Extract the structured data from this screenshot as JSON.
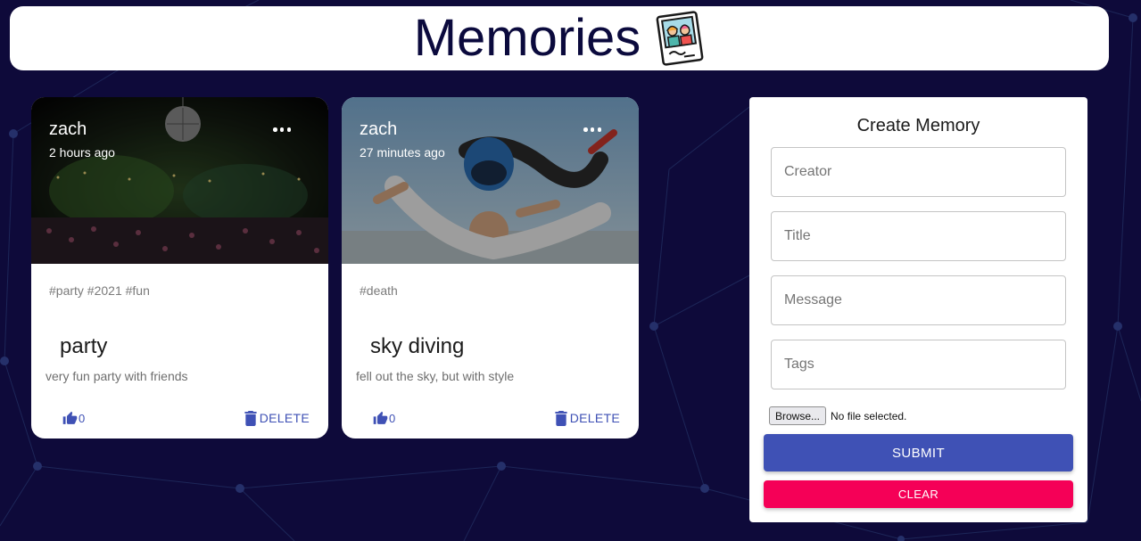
{
  "app": {
    "title": "Memories",
    "logo_icon": "memories-photo-logo-icon"
  },
  "posts": [
    {
      "creator": "zach",
      "time": "2 hours ago",
      "tags": "#party #2021 #fun",
      "title": "party",
      "message": "very fun party with friends",
      "likes": "0",
      "delete_label": "DELETE",
      "image": "concert-crowd-disco-ball"
    },
    {
      "creator": "zach",
      "time": "27 minutes ago",
      "tags": "#death",
      "title": "sky diving",
      "message": "fell out the sky, but with style",
      "likes": "0",
      "delete_label": "DELETE",
      "image": "tandem-skydivers"
    }
  ],
  "form": {
    "title": "Create Memory",
    "creator_placeholder": "Creator",
    "title_placeholder": "Title",
    "message_placeholder": "Message",
    "tags_placeholder": "Tags",
    "browse_label": "Browse...",
    "file_status": "No file selected.",
    "submit_label": "SUBMIT",
    "clear_label": "CLEAR"
  },
  "colors": {
    "background": "#0e0a3a",
    "primary": "#3f51b5",
    "secondary": "#f50057",
    "title_text": "#0b0a3d"
  }
}
